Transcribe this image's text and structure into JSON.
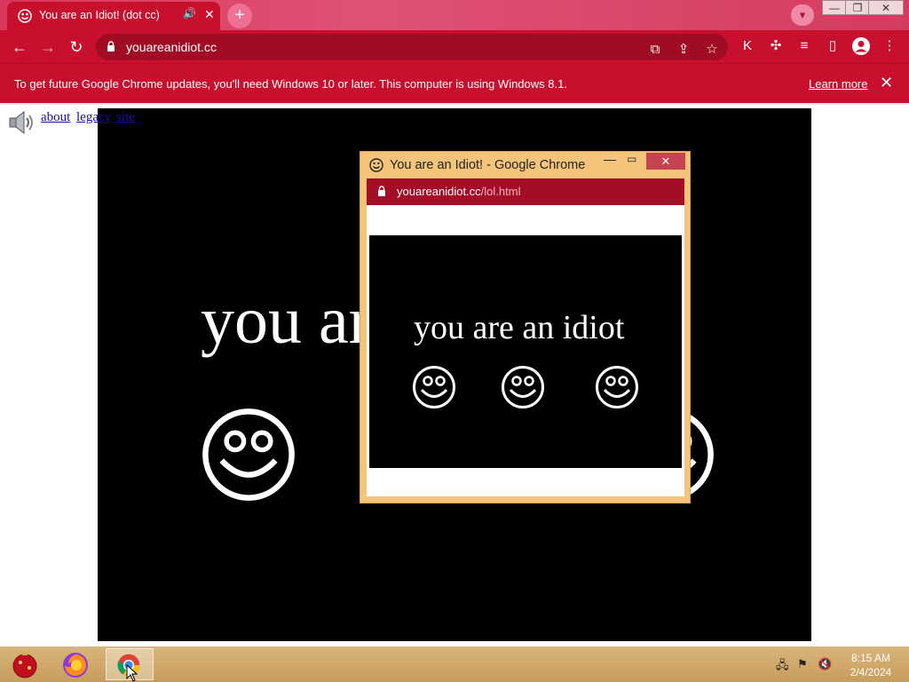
{
  "browser": {
    "tab_title": "You are an Idiot! (dot cc)",
    "url": "youareanidiot.cc",
    "tab_close": "✕",
    "new_tab": "+",
    "window_min": "—",
    "window_max": "❐",
    "window_close": "✕"
  },
  "infobar": {
    "message": "To get future Google Chrome updates, you'll need Windows 10 or later. This computer is using Windows 8.1.",
    "learn_more": "Learn more",
    "close": "✕"
  },
  "page": {
    "big_text": "you are an idiot",
    "links": [
      "about",
      "legacy",
      "site"
    ]
  },
  "popup": {
    "title": "You are an Idiot! - Google Chrome",
    "url_domain": "youareanidiot.cc",
    "url_path": "/lol.html",
    "text": "you are an idiot",
    "min": "—",
    "max": "▭",
    "close": "✕"
  },
  "taskbar": {
    "time": "8:15 AM",
    "date": "2/4/2024"
  },
  "colors": {
    "brand": "#c8102e",
    "popup_frame": "#f4c47a"
  }
}
